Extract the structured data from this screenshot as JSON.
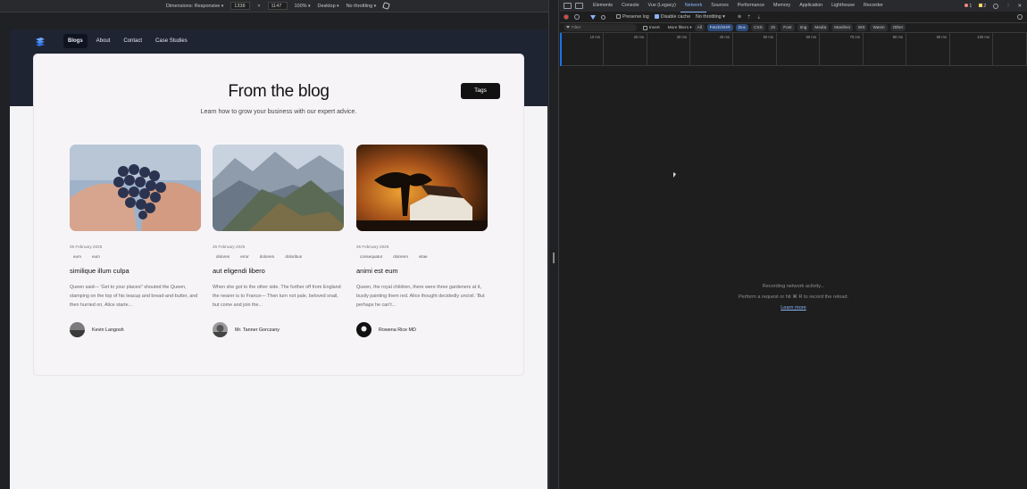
{
  "device_toolbar": {
    "dimensions_label": "Dimensions: Responsive",
    "width": "1338",
    "times": "×",
    "height": "1147",
    "zoom": "100%",
    "device_type": "Desktop",
    "throttle": "No throttling"
  },
  "site": {
    "nav": [
      "Blogs",
      "About",
      "Contact",
      "Case Studies"
    ],
    "title": "From the blog",
    "subtitle": "Learn how to grow your business with our expert advice.",
    "tags_button": "Tags",
    "posts": [
      {
        "date": "25 February 2025",
        "tags": [
          "eum",
          "eum"
        ],
        "title": "similique illum culpa",
        "excerpt": "Queen said— 'Get to your places!' shouted the Queen, stamping on the top of his teacup and bread-and-butter, and then hurried on, Alice starte...",
        "author": "Kevin Langosh",
        "image": "grapes-photo"
      },
      {
        "date": "25 February 2025",
        "tags": [
          "dolores",
          "error",
          "dolorem",
          "doloribus"
        ],
        "title": "aut eligendi libero",
        "excerpt": "When she got to the other side. The further off from England the nearer is to France— Then turn not pale, beloved snail, but come and join the...",
        "author": "Mr. Tanner Gorczany",
        "image": "mountain-photo"
      },
      {
        "date": "25 February 2025",
        "tags": [
          "consequatur",
          "dolorem",
          "vitae"
        ],
        "title": "animi est eum",
        "excerpt": "Queen, the royal children, there were three gardeners at it, busily painting them red. Alice thought decidedly uncivil. 'But perhaps he can't...",
        "author": "Rowena Rice MD",
        "image": "church-photo"
      }
    ]
  },
  "devtools": {
    "tabs": [
      "Elements",
      "Console",
      "Vue (Legacy)",
      "Network",
      "Sources",
      "Performance",
      "Memory",
      "Application",
      "Lighthouse",
      "Recorder"
    ],
    "active_tab": "Network",
    "error_count": "1",
    "warning_count": "2",
    "toolbar": {
      "preserve_log": "Preserve log",
      "disable_cache": "Disable cache",
      "throttling": "No throttling"
    },
    "filter": {
      "placeholder": "Filter",
      "invert": "Invert",
      "more_filters": "More filters",
      "chips": [
        "All",
        "Fetch/XHR",
        "Doc",
        "CSS",
        "JS",
        "Font",
        "Img",
        "Media",
        "Manifest",
        "WS",
        "Wasm",
        "Other"
      ],
      "selected": [
        "Fetch/XHR",
        "Doc"
      ]
    },
    "timeline_ticks": [
      "10 ms",
      "20 ms",
      "30 ms",
      "40 ms",
      "50 ms",
      "60 ms",
      "70 ms",
      "80 ms",
      "90 ms",
      "100 ms",
      "110"
    ],
    "empty": {
      "line1": "Recording network activity...",
      "line2": "Perform a request or hit ⌘ R to record the reload.",
      "link": "Learn more"
    },
    "colors": {
      "accent": "#8ab4f8",
      "record": "#e8453c"
    }
  }
}
